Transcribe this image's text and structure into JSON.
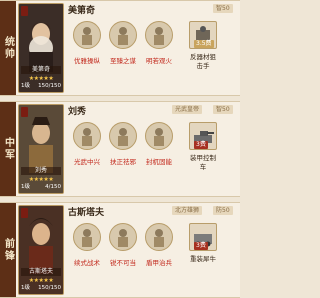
{
  "cards": [
    {
      "role": "统帅",
      "name": "美第奇",
      "portrait_name": "美第奇",
      "stars": "★★★★★",
      "level": "1级",
      "troops": "150/150",
      "camp_tag": "",
      "wis_tag": "智50",
      "skills": [
        "优雅操纵",
        "至臻之谋",
        "明若观火"
      ],
      "equip_label_1": "反器材狙",
      "equip_label_2": "击手",
      "cost": "3.5费"
    },
    {
      "role": "中军",
      "name": "刘秀",
      "portrait_name": "刘秀",
      "stars": "★★★★★",
      "level": "1级",
      "troops": "4/150",
      "camp_tag": "光武皇帝",
      "wis_tag": "智50",
      "skills": [
        "光武中兴",
        "扶正祛邪",
        "封杌固能"
      ],
      "equip_label_1": "装甲控制",
      "equip_label_2": "车",
      "cost": "3费"
    },
    {
      "role": "前锋",
      "name": "古斯塔夫",
      "portrait_name": "古斯塔夫",
      "stars": "★★★★★",
      "level": "1级",
      "troops": "150/150",
      "camp_tag": "北方雄狮",
      "wis_tag": "防50",
      "skills": [
        "续式战术",
        "锐不可当",
        "盾甲治兵"
      ],
      "equip_label_1": "重装犀牛",
      "equip_label_2": "",
      "cost": "3费"
    }
  ],
  "colors": {
    "role_bg": "#5d2f16",
    "skill_text": "#c2281c",
    "star": "#f5c54a"
  }
}
